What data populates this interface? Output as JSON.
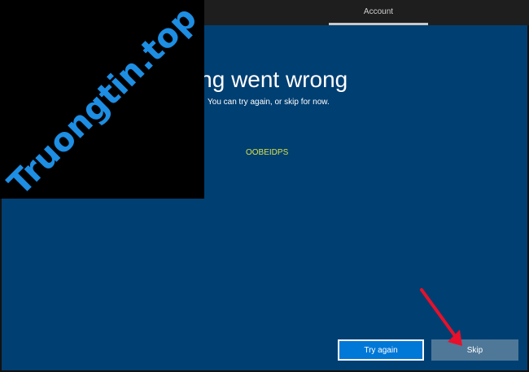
{
  "header": {
    "tab_label": "Account"
  },
  "main": {
    "heading": "ething went wrong",
    "subtitle": "You can try again, or skip for now.",
    "error_code": "OOBEIDPS"
  },
  "buttons": {
    "try_again": "Try again",
    "skip": "Skip"
  },
  "watermark": {
    "text": "Truongtin.top"
  },
  "colors": {
    "background": "#003f72",
    "primary_button": "#0078d7",
    "secondary_button": "#4f7898",
    "error_code": "#d9e34a",
    "arrow": "#e8102a",
    "watermark": "#1d8ee3"
  },
  "icons": {
    "annotation": "arrow-pointer-icon"
  }
}
